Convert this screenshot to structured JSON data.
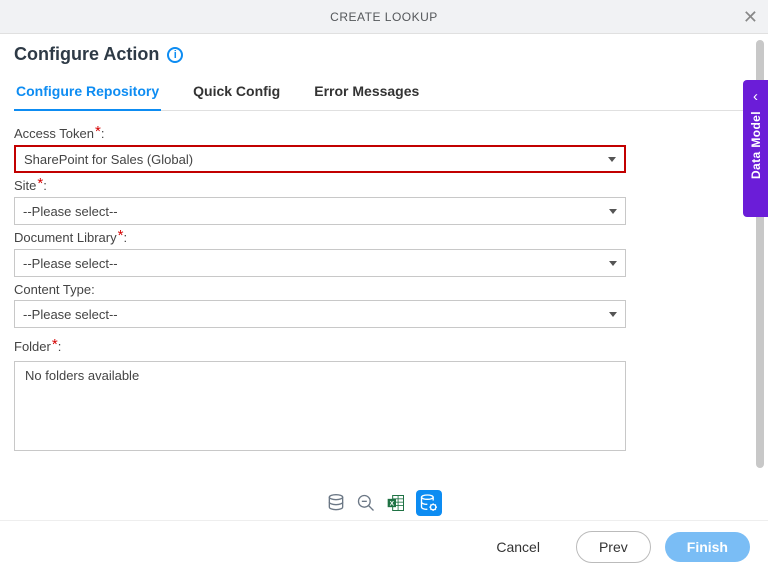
{
  "dialog": {
    "title": "CREATE LOOKUP"
  },
  "section": {
    "title": "Configure Action"
  },
  "tabs": [
    {
      "label": "Configure Repository",
      "active": true
    },
    {
      "label": "Quick Config",
      "active": false
    },
    {
      "label": "Error Messages",
      "active": false
    }
  ],
  "fields": {
    "access_token": {
      "label": "Access Token",
      "required": true,
      "value": "SharePoint for Sales (Global)"
    },
    "site": {
      "label": "Site",
      "required": true,
      "value": "--Please select--"
    },
    "document_library": {
      "label": "Document Library",
      "required": true,
      "value": "--Please select--"
    },
    "content_type": {
      "label": "Content Type:",
      "required": false,
      "value": "--Please select--"
    },
    "folder": {
      "label": "Folder",
      "required": true,
      "value": "No folders available"
    }
  },
  "side_panel": {
    "label": "Data Model"
  },
  "footer": {
    "cancel": "Cancel",
    "prev": "Prev",
    "finish": "Finish"
  }
}
